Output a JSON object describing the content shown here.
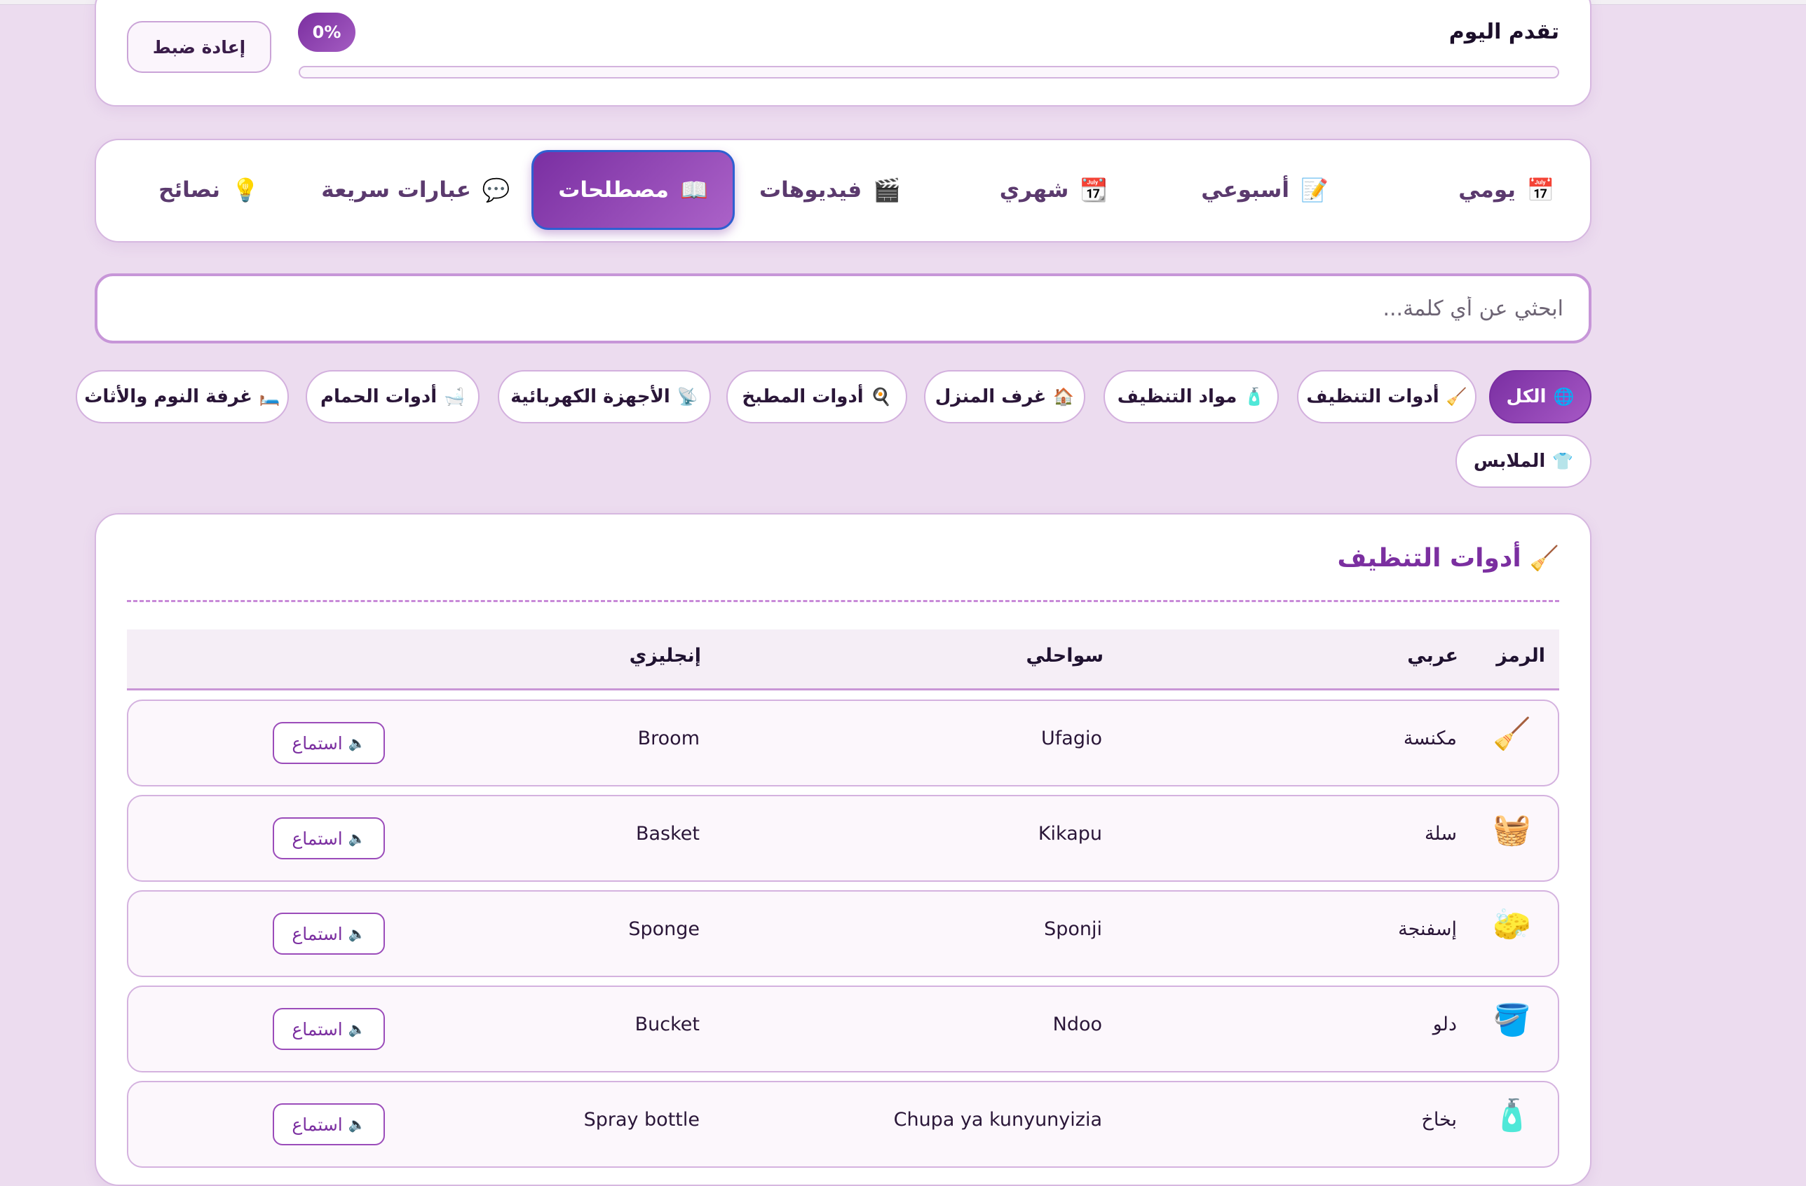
{
  "progress": {
    "title": "تقدم اليوم",
    "percent_label": "0%",
    "percent_value": 0,
    "reset_label": "إعادة ضبط"
  },
  "tabs": [
    {
      "icon": "📅",
      "icon_name": "calendar-icon",
      "label": "يومي",
      "active": false
    },
    {
      "icon": "📝",
      "icon_name": "notepad-icon",
      "label": "أسبوعي",
      "active": false
    },
    {
      "icon": "📆",
      "icon_name": "calendar-month-icon",
      "label": "شهري",
      "active": false
    },
    {
      "icon": "🎬",
      "icon_name": "clapper-icon",
      "label": "فيديوهات",
      "active": false
    },
    {
      "icon": "📖",
      "icon_name": "book-icon",
      "label": "مصطلحات",
      "active": true
    },
    {
      "icon": "💬",
      "icon_name": "speech-bubble-icon",
      "label": "عبارات سريعة",
      "active": false
    },
    {
      "icon": "💡",
      "icon_name": "lightbulb-icon",
      "label": "نصائح",
      "active": false
    }
  ],
  "search": {
    "placeholder": "ابحثي عن أي كلمة...",
    "value": ""
  },
  "categories": [
    {
      "icon": "🌐",
      "icon_name": "globe-icon",
      "label": "الكل",
      "active": true
    },
    {
      "icon": "🧹",
      "icon_name": "broom-icon",
      "label": "أدوات التنظيف",
      "active": false
    },
    {
      "icon": "🧴",
      "icon_name": "lotion-bottle-icon",
      "label": "مواد التنظيف",
      "active": false
    },
    {
      "icon": "🏠",
      "icon_name": "house-icon",
      "label": "غرف المنزل",
      "active": false
    },
    {
      "icon": "🍳",
      "icon_name": "frying-pan-icon",
      "label": "أدوات المطبخ",
      "active": false
    },
    {
      "icon": "📡",
      "icon_name": "satellite-icon",
      "label": "الأجهزة الكهربائية",
      "active": false
    },
    {
      "icon": "🛁",
      "icon_name": "bathtub-icon",
      "label": "أدوات الحمام",
      "active": false
    },
    {
      "icon": "🛏️",
      "icon_name": "bed-icon",
      "label": "غرفة النوم والأثاث",
      "active": false
    },
    {
      "icon": "👕",
      "icon_name": "shirt-icon",
      "label": "الملابس",
      "active": false
    }
  ],
  "section": {
    "icon": "🧹",
    "icon_name": "broom-icon",
    "title": "أدوات التنظيف",
    "columns": {
      "symbol": "الرمز",
      "arabic": "عربي",
      "swahili": "سواحلي",
      "english": "إنجليزي"
    },
    "listen_label": "استماع",
    "listen_icon": "🔈",
    "rows": [
      {
        "symbol": "🧹",
        "symbol_name": "broom-icon",
        "arabic": "مكنسة",
        "swahili": "Ufagio",
        "english": "Broom"
      },
      {
        "symbol": "🧺",
        "symbol_name": "basket-icon",
        "arabic": "سلة",
        "swahili": "Kikapu",
        "english": "Basket"
      },
      {
        "symbol": "🧽",
        "symbol_name": "sponge-icon",
        "arabic": "إسفنجة",
        "swahili": "Sponji",
        "english": "Sponge"
      },
      {
        "symbol": "🪣",
        "symbol_name": "bucket-icon",
        "arabic": "دلو",
        "swahili": "Ndoo",
        "english": "Bucket"
      },
      {
        "symbol": "🧴",
        "symbol_name": "spray-bottle-icon",
        "arabic": "بخاخ",
        "swahili": "Chupa ya kunyunyizia",
        "english": "Spray bottle"
      }
    ]
  },
  "colors": {
    "accent": "#7b2fa0",
    "background": "#ecdcef",
    "active_tab_border": "#2f5fd1"
  }
}
